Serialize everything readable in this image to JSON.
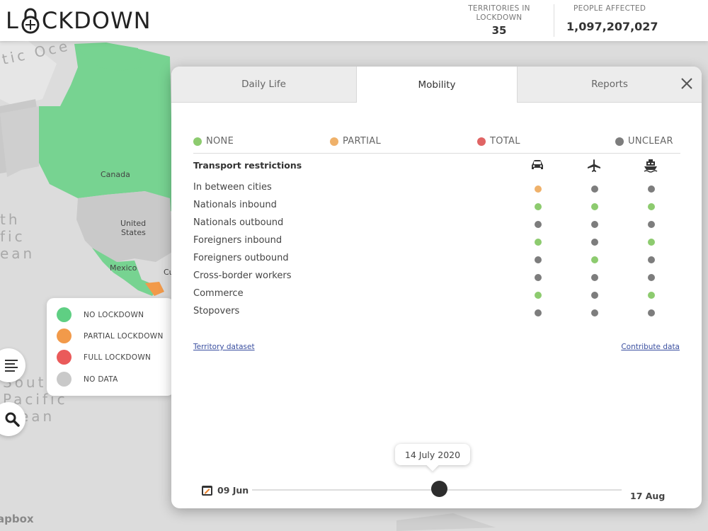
{
  "header": {
    "logo_left": "L",
    "logo_right": "CKDOWN",
    "stats": [
      {
        "label_line1": "TERRITORIES IN",
        "label_line2": "LOCKDOWN",
        "value": "35"
      },
      {
        "label_line1": "PEOPLE AFFECTED",
        "label_line2": "",
        "value": "1,097,207,027"
      }
    ]
  },
  "map": {
    "ocean_labels": [
      "tic Oce",
      "th",
      "fic",
      "ean",
      "Sout",
      "Pacific",
      "ean"
    ],
    "country_labels": [
      "Canada",
      "United",
      "States",
      "Mexico",
      "Cu"
    ],
    "attribution": "apbox",
    "colors": {
      "no_lockdown": "#77d391",
      "partial": "#f29a4a",
      "no_data": "#c9c9c9",
      "land_bg": "#dcdcdc"
    }
  },
  "legend": {
    "items": [
      {
        "label": "NO LOCKDOWN",
        "color": "#5fcf83"
      },
      {
        "label": "PARTIAL LOCKDOWN",
        "color": "#f29a4a"
      },
      {
        "label": "FULL LOCKDOWN",
        "color": "#ea5a5a"
      },
      {
        "label": "NO DATA",
        "color": "#c9c9c9"
      }
    ],
    "menu_icon": "menu-icon",
    "search_icon": "search-icon"
  },
  "modal": {
    "tabs": [
      "Daily Life",
      "Mobility",
      "Reports"
    ],
    "active_tab": "Mobility",
    "statuses": [
      {
        "label": "NONE",
        "color": "#8dcb6f"
      },
      {
        "label": "PARTIAL",
        "color": "#efb16a"
      },
      {
        "label": "TOTAL",
        "color": "#e06464"
      },
      {
        "label": "UNCLEAR",
        "color": "#7d7d7d"
      }
    ],
    "section_title": "Transport restrictions",
    "columns": [
      "car-icon",
      "plane-icon",
      "ship-icon"
    ],
    "rows": [
      {
        "label": "In between cities",
        "values": [
          "partial",
          "unclear",
          "unclear"
        ]
      },
      {
        "label": "Nationals inbound",
        "values": [
          "none",
          "none",
          "none"
        ]
      },
      {
        "label": "Nationals outbound",
        "values": [
          "unclear",
          "unclear",
          "unclear"
        ]
      },
      {
        "label": "Foreigners inbound",
        "values": [
          "none",
          "unclear",
          "none"
        ]
      },
      {
        "label": "Foreigners outbound",
        "values": [
          "unclear",
          "none",
          "unclear"
        ]
      },
      {
        "label": "Cross-border workers",
        "values": [
          "unclear",
          "unclear",
          "unclear"
        ]
      },
      {
        "label": "Commerce",
        "values": [
          "none",
          "unclear",
          "none"
        ]
      },
      {
        "label": "Stopovers",
        "values": [
          "unclear",
          "unclear",
          "unclear"
        ]
      }
    ],
    "links": {
      "territory": "Territory dataset",
      "contribute": "Contribute data"
    },
    "timeline": {
      "current": "14 July 2020",
      "start": "09 Jun",
      "end": "17 Aug",
      "position": 0.5
    }
  }
}
